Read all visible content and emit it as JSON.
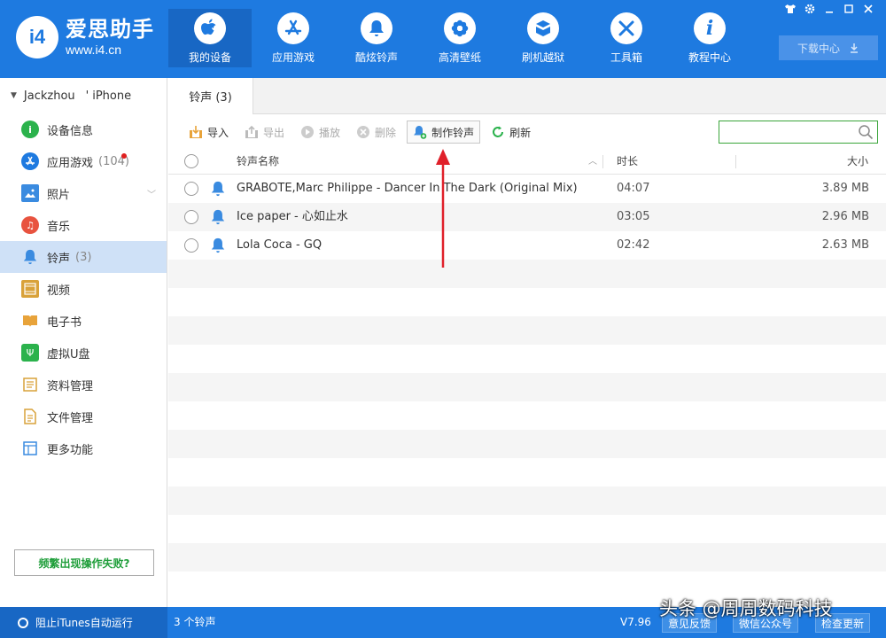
{
  "app": {
    "logo_badge": "i4",
    "name": "爱思助手",
    "url": "www.i4.cn"
  },
  "nav": [
    {
      "label": "我的设备",
      "icon": "apple-icon"
    },
    {
      "label": "应用游戏",
      "icon": "appstore-icon"
    },
    {
      "label": "酷炫铃声",
      "icon": "bell-icon"
    },
    {
      "label": "高清壁纸",
      "icon": "flower-icon"
    },
    {
      "label": "刷机越狱",
      "icon": "box-icon"
    },
    {
      "label": "工具箱",
      "icon": "tools-icon"
    },
    {
      "label": "教程中心",
      "icon": "info-icon"
    }
  ],
  "window_controls": [
    "shirt-icon",
    "gear-icon",
    "minimize-icon",
    "maximize-icon",
    "close-icon"
  ],
  "download_center": "下载中心",
  "device": {
    "owner": "Jackzhou",
    "separator": "'",
    "model": "iPhone"
  },
  "sidebar": {
    "items": [
      {
        "label": "设备信息",
        "icon": "info-icon",
        "color": "#2bb24c"
      },
      {
        "label": "应用游戏",
        "count": "(104)",
        "icon": "appstore-icon",
        "color": "#1e7ae0",
        "badge": true
      },
      {
        "label": "照片",
        "icon": "photo-icon",
        "color": "#3a8be0",
        "chevron": true
      },
      {
        "label": "音乐",
        "icon": "music-icon",
        "color": "#e8533f"
      },
      {
        "label": "铃声",
        "count": "(3)",
        "icon": "bell-icon",
        "color": "#3a8be0",
        "active": true
      },
      {
        "label": "视频",
        "icon": "film-icon",
        "color": "#d9a23a"
      },
      {
        "label": "电子书",
        "icon": "book-icon",
        "color": "#e8a33a"
      },
      {
        "label": "虚拟U盘",
        "icon": "usb-icon",
        "color": "#2bb24c"
      },
      {
        "label": "资料管理",
        "icon": "contacts-icon",
        "color": "#d9a23a"
      },
      {
        "label": "文件管理",
        "icon": "file-icon",
        "color": "#d9a23a"
      },
      {
        "label": "更多功能",
        "icon": "grid-icon",
        "color": "#3a8be0"
      }
    ],
    "help": "频繁出现操作失败?"
  },
  "tab": {
    "label": "铃声 (3)"
  },
  "toolbar": {
    "import": "导入",
    "export": "导出",
    "play": "播放",
    "delete": "删除",
    "make_ringtone": "制作铃声",
    "refresh": "刷新",
    "search_placeholder": ""
  },
  "table": {
    "headers": {
      "name": "铃声名称",
      "duration": "时长",
      "size": "大小"
    },
    "rows": [
      {
        "name": "GRABOTE,Marc Philippe - Dancer In The Dark (Original Mix)",
        "duration": "04:07",
        "size": "3.89 MB"
      },
      {
        "name": "Ice paper - 心如止水",
        "duration": "03:05",
        "size": "2.96 MB"
      },
      {
        "name": "Lola Coca - GQ",
        "duration": "02:42",
        "size": "2.63 MB"
      }
    ]
  },
  "status": {
    "itunes": "阻止iTunes自动运行",
    "count": "3 个铃声",
    "version": "V7.96",
    "feedback": "意见反馈",
    "wechat": "微信公众号",
    "check_update": "检查更新"
  },
  "watermark": "头条 @周周数码科技",
  "colors": {
    "brand": "#1e7ae0",
    "accent_green": "#2bb24c",
    "arrow": "#e0202a"
  }
}
